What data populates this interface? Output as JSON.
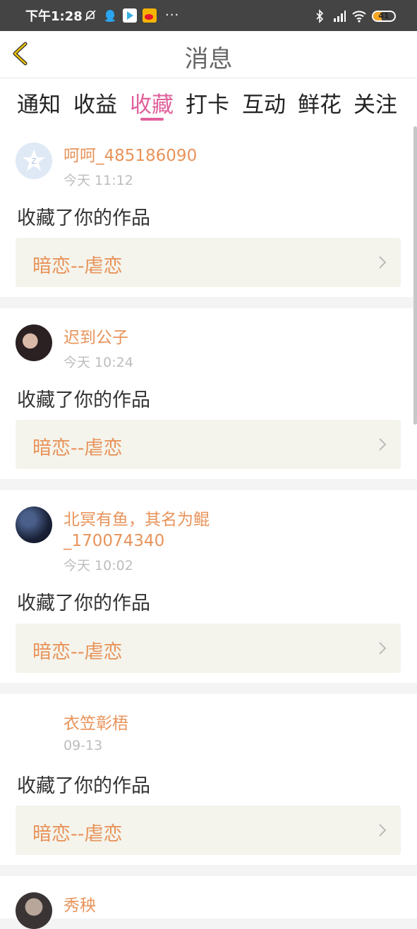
{
  "status_bar": {
    "time": "下午1:28",
    "left_icons": [
      "mute-bell-icon",
      "qq-icon",
      "play-store-icon",
      "weibo-icon"
    ],
    "overflow": "···",
    "battery": "41",
    "battery_fraction": 0.41
  },
  "header": {
    "title": "消息"
  },
  "tabs": [
    {
      "label": "通知"
    },
    {
      "label": "收益"
    },
    {
      "label": "收藏"
    },
    {
      "label": "打卡"
    },
    {
      "label": "互动"
    },
    {
      "label": "鲜花"
    },
    {
      "label": "关注"
    }
  ],
  "active_tab": "收藏",
  "messages": [
    {
      "user": "呵呵_485186090",
      "time": "今天 11:12",
      "action": "收藏了你的作品",
      "work": "暗恋--虐恋"
    },
    {
      "user": "迟到公子",
      "time": "今天 10:24",
      "action": "收藏了你的作品",
      "work": "暗恋--虐恋"
    },
    {
      "user": "北冥有鱼，其名为鲲",
      "user_line2": "_170074340",
      "time": "今天 10:02",
      "action": "收藏了你的作品",
      "work": "暗恋--虐恋"
    },
    {
      "user": "衣笠彰梧",
      "time": "09-13",
      "action": "收藏了你的作品",
      "work": "暗恋--虐恋"
    },
    {
      "user": "秀秧"
    }
  ],
  "colors": {
    "accent_pink": "#e0609b",
    "username_orange": "#e8935a",
    "header_bar": "#444444"
  }
}
